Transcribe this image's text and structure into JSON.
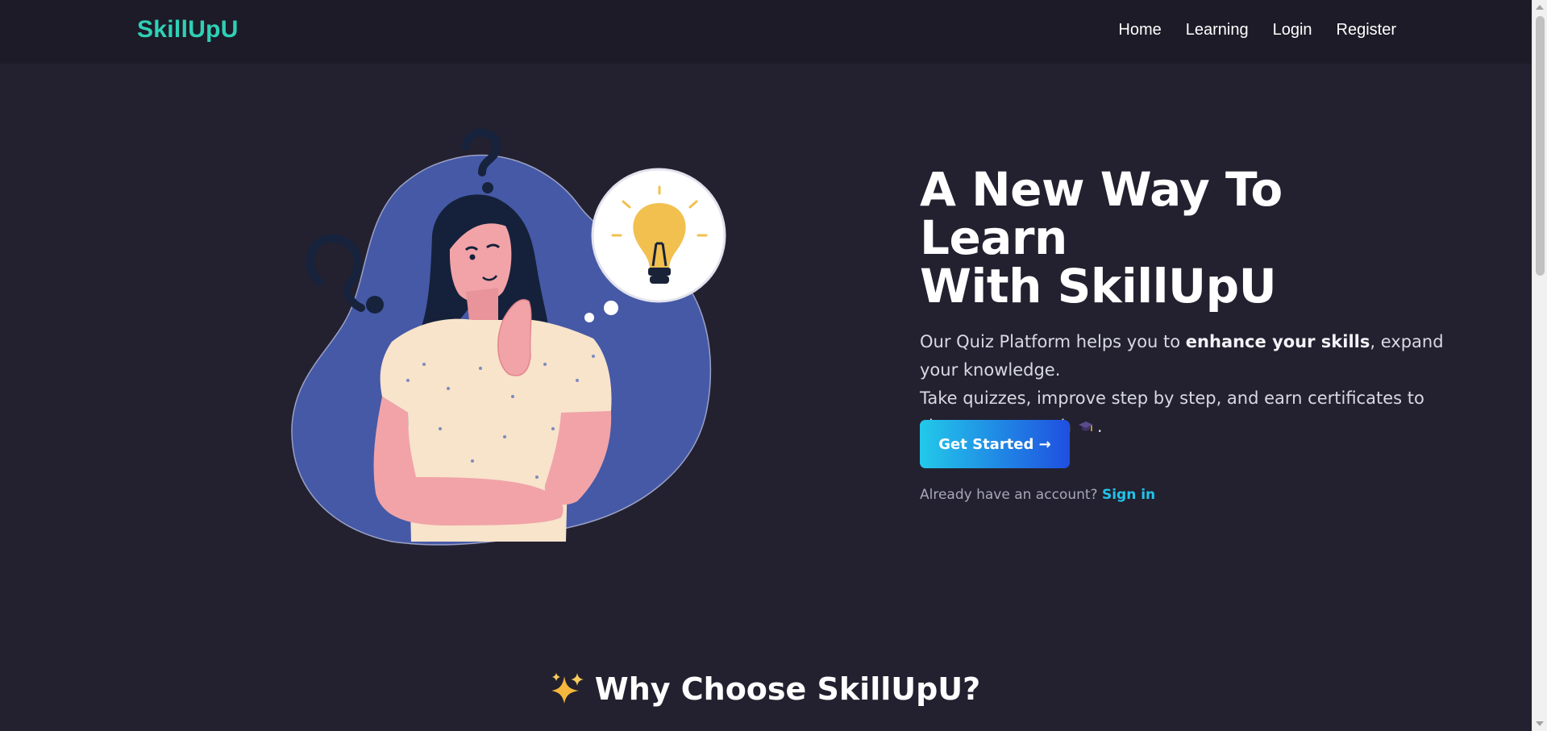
{
  "nav": {
    "brand": "SkillUpU",
    "links": [
      "Home",
      "Learning",
      "Login",
      "Register"
    ]
  },
  "hero": {
    "title_line1": "A New Way To Learn",
    "title_line2": "With SkillUpU",
    "desc_part1": "Our Quiz Platform helps you to ",
    "desc_bold": "enhance your skills",
    "desc_part2": ", expand your knowledge.",
    "desc_line2": "Take quizzes, improve step by step, and earn certificates to show your growth",
    "desc_end": ".",
    "cta_label": "Get Started →",
    "signin_prompt": "Already have an account?",
    "signin_link": "Sign in"
  },
  "features": {
    "title": "Why Choose SkillUpU?"
  },
  "icons": {
    "sparkle": "sparkles-icon",
    "cap": "graduation-cap-icon",
    "illustration": "thinking-woman-illustration"
  },
  "colors": {
    "background": "#23212f",
    "navbar": "#1c1b27",
    "brand": "#2fd0b6",
    "accent_link": "#22c3ea",
    "cta_gradient_start": "#22c9ea",
    "cta_gradient_end": "#1f4fe0",
    "blob": "#4559a6"
  }
}
